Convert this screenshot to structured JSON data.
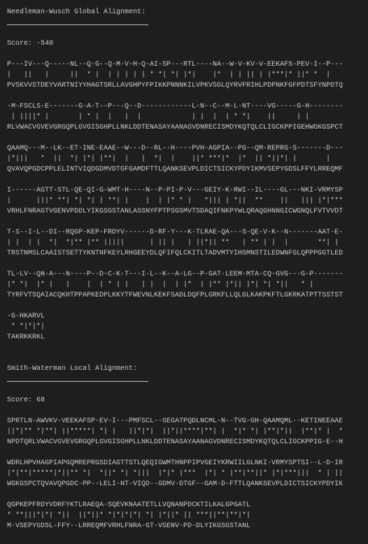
{
  "sections": [
    {
      "id": "global",
      "title": "Needleman-Wusch Global Alignment:",
      "score_label": "Score: -540",
      "blocks": [
        {
          "top": "P---IV---Q-----NL--Q-G--Q-M-V-H-Q-AI-SP---RTL----NA--W-V-KV-V-EEKAFS-PEV-I--P---",
          "match": "|   ||   |     ||  * |  | | | | | * *| *| |*|    |*  | | || | |***|* ||* *  |   ",
          "bottom": "PVSKVVSTDEYVARTNIYYHAGTSRLLAVGHPYFPIKKPNNNKILVPKVSGLQYRVFRIHLPDPNKFGFPDTSFYNPDTQ"
        },
        {
          "top": "-M-FSCLS-E-------G-A-T--P---Q--D------------L-N--C--M-L-NT----VG-----G-H--------",
          "match": " | ||||* |       | * |  |   |  |            | |  |  | * *|    ||     | |        ",
          "bottom": "RLVWACVGVEVGRGQPLGVGISGHPLLNKLDDTENASAYAANAGVDNRECISMDYKQTQLCLIGCKPPIGEHWGKGSPCT"
        },
        {
          "top": "QAAMQ---M--LK--ET-INE-EAAE--W---D--RL--H----PVH-AGPIA--PG--QM-REPRG-S-------D---",
          "match": "|*|||   *  ||  *| |*| |**|  |   |  *|  |    ||* ***|*  |*  || *||*| |       |   ",
          "bottom": "QVAVQPGDCPPLELINTVIQDGDMVDTGFGAMDFTTLQANKSEVPLDICTSICKYPDYIKMVSEPYGDSLFFYLRREQMF"
        },
        {
          "top": "I------AGTT-STL-QE-QI-G-WMT-H----N--P-PI-P-V---GEIY-K-RWI--IL----GL---NKI-VRMYSP",
          "match": "|      |||* **| *| *| | **| |    |  | |* * |   *||| | *||  **    ||   ||| |*|***",
          "bottom": "VRHLFNRAGTVGENVPDDLYIKGSGSTANLASSNYFPTPSGSMVTSDAQIFNKPYWLQRAQGHNNGICWGNQLFVTVVDT"
        },
        {
          "top": "T-S--I-L--DI--RQGP-KEP-FRDYV------D-RF-Y---K-TLRAE-QA---S-QE-V-K--N-------AAT-E-",
          "match": "| |  | |  *|  *|** |** |||||      | || |   | ||*|| **   | ** | |  |       **| | ",
          "bottom": "TRSTNMSLCAAISTSETTYKNTNFKEYLRHGEEYDLQFIFQLCKITLTADVMTYIHSMNSTILEDWNFGLQPPPGGTLED"
        },
        {
          "top": "TL-LV--QN-A---N----P--D-C-K-T---I-L--K--A-LG--P-GAT-LEEM-MTA-CQ-GVG---G-P-------",
          "match": "|* *|  |* |   |    |  | * | |   | |  |  | |*  | |** |*|| |*| *| *||   * |       ",
          "bottom": "TYRFVTSQAIACQKHTPPAPKEDPLKKYTFWEVNLKEKFSADLDQFPLGRKFLLQLGLKAKPKFTLGKRKATPTTSSTST"
        },
        {
          "top": "-G-HKARVL",
          "match": " * *|*|*|",
          "bottom": "TAKRKKRKL"
        }
      ]
    },
    {
      "id": "local",
      "title": "Smith-Waterman Local Alignment:",
      "score_label": "Score: 68",
      "blocks": [
        {
          "top": "SPRTLN-AWVKV-VEEKAFSP-EV-I---PMFSCL--SEGATPQDLNCML-N--TVG-GH-QAAMQML--KETINEEAAE",
          "match": "||*|** *|**| ||*****| *| |   ||*|*|  ||*||****|**| |  *|* *| |**|*||  |**|* |  *",
          "bottom": "NPDTQRLVWACVGVEVGRGQPLGVGISGHPLLNKLDDTENASAYAANAGVDNRECISMDYKQTQLCLIGCKPPIG-E--H"
        },
        {
          "top": "WDRLHPVHAGPIAPGQMREPRGSDIAGTTSTLQEQIGWMTHNPPIPVGEIYKRWIILGLNKI-VRMYSPTSI--L-D-IR",
          "match": "|*|**|*****|*||** *|  *||* *| *|||  |*|* |***  |*| * |**|**||* |*|***|||  * | ||",
          "bottom": "WGKGSPCTQVAVQPGDC-PP--LELI-NT-VIQD--GDMV-DTGF--GAM-D-FTTLQANKSEVPLDICTSICKYPDYIK"
        },
        {
          "top": "QGPKEPFRDYVDRFYKTLRAEQA-SQEVKNAATETLLVQNANPDCKTILKALGPGATL",
          "match": "* **|||*|*| *||  ||*||* *|*|*|*| *| |*||* || ***||**|**|*|",
          "bottom": "M-VSEPYGDSL-FFY--LRREQMFVRHLFNRA-GT-VGENV-PD-DLYIKGSGSTANL"
        }
      ]
    }
  ]
}
